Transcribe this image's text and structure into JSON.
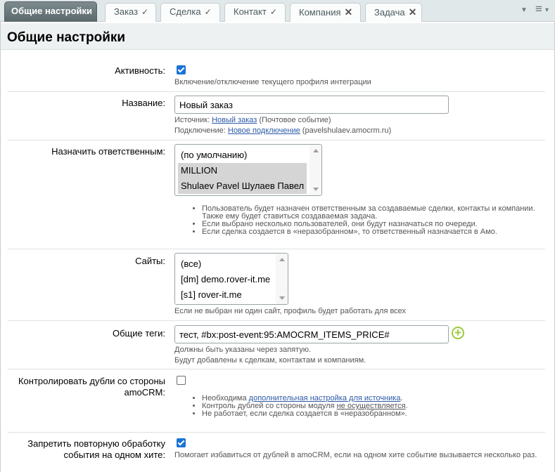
{
  "tabs": [
    {
      "label": "Общие настройки",
      "status": ""
    },
    {
      "label": "Заказ",
      "status": "✓"
    },
    {
      "label": "Сделка",
      "status": "✓"
    },
    {
      "label": "Контакт",
      "status": "✓"
    },
    {
      "label": "Компания",
      "status": "✕"
    },
    {
      "label": "Задача",
      "status": "✕"
    }
  ],
  "toolbar": {
    "dropdown_icon": "▼",
    "menu_icon": "≡",
    "menu_caret": "▾"
  },
  "page_title": "Общие настройки",
  "activity": {
    "label": "Активность:",
    "checked": true,
    "hint": "Включение/отключение текущего профиля интеграции"
  },
  "name": {
    "label": "Название:",
    "value": "Новый заказ",
    "source_prefix": "Источник: ",
    "source_link": "Новый заказ",
    "source_suffix": " (Почтовое событие)",
    "conn_prefix": "Подключение: ",
    "conn_link": "Новое подключение",
    "conn_suffix": " (pavelshulaev.amocrm.ru)"
  },
  "responsible": {
    "label": "Назначить ответственным:",
    "options": [
      {
        "text": "(по умолчанию)",
        "selected": false
      },
      {
        "text": "MILLION",
        "selected": true
      },
      {
        "text": "Shulaev Pavel Шулаев Павел",
        "selected": true
      }
    ],
    "notes": [
      "Пользователь будет назначен ответственным за создаваемые сделки, контакты и компании. Также ему будет ставиться создаваемая задача.",
      "Если выбрано несколько пользователей, они будут назначаться по очереди.",
      "Если сделка создается в «неразобранном», то ответственный назначается в Амо."
    ]
  },
  "sites": {
    "label": "Сайты:",
    "options": [
      "(все)",
      "[dm] demo.rover-it.me",
      "[s1] rover-it.me"
    ],
    "hint": "Если не выбран ни один сайт, профиль будет работать для всех"
  },
  "tags": {
    "label": "Общие теги:",
    "value": "тест, #bx:post-event:95:AMOCRM_ITEMS_PRICE#",
    "hint1": "Должны быть указаны через запятую.",
    "hint2": "Будут добавлены к сделкам, контактам и компаниям.",
    "add_icon": "+"
  },
  "duplicates": {
    "label_line1": "Контролировать дубли со стороны",
    "label_line2": "amoCRM:",
    "checked": false,
    "note1_prefix": "Необходима ",
    "note1_link": "дополнительная настройка для источника",
    "note1_suffix": ".",
    "note2_prefix": "Контроль дублей со стороны модуля ",
    "note2_link": "не осуществляется",
    "note2_suffix": ".",
    "note3": "Не работает, если сделка создается в «неразобранном»."
  },
  "repeat": {
    "label_line1": "Запретить повторную обработку",
    "label_line2": "события на одном хите:",
    "checked": true,
    "hint": "Помогает избавиться от дублей в amoCRM, если на одном хите событие вызывается несколько раз."
  },
  "colors": {
    "accent": "#1a73d6",
    "link": "#2b5aa8",
    "add": "#9cc93b"
  }
}
